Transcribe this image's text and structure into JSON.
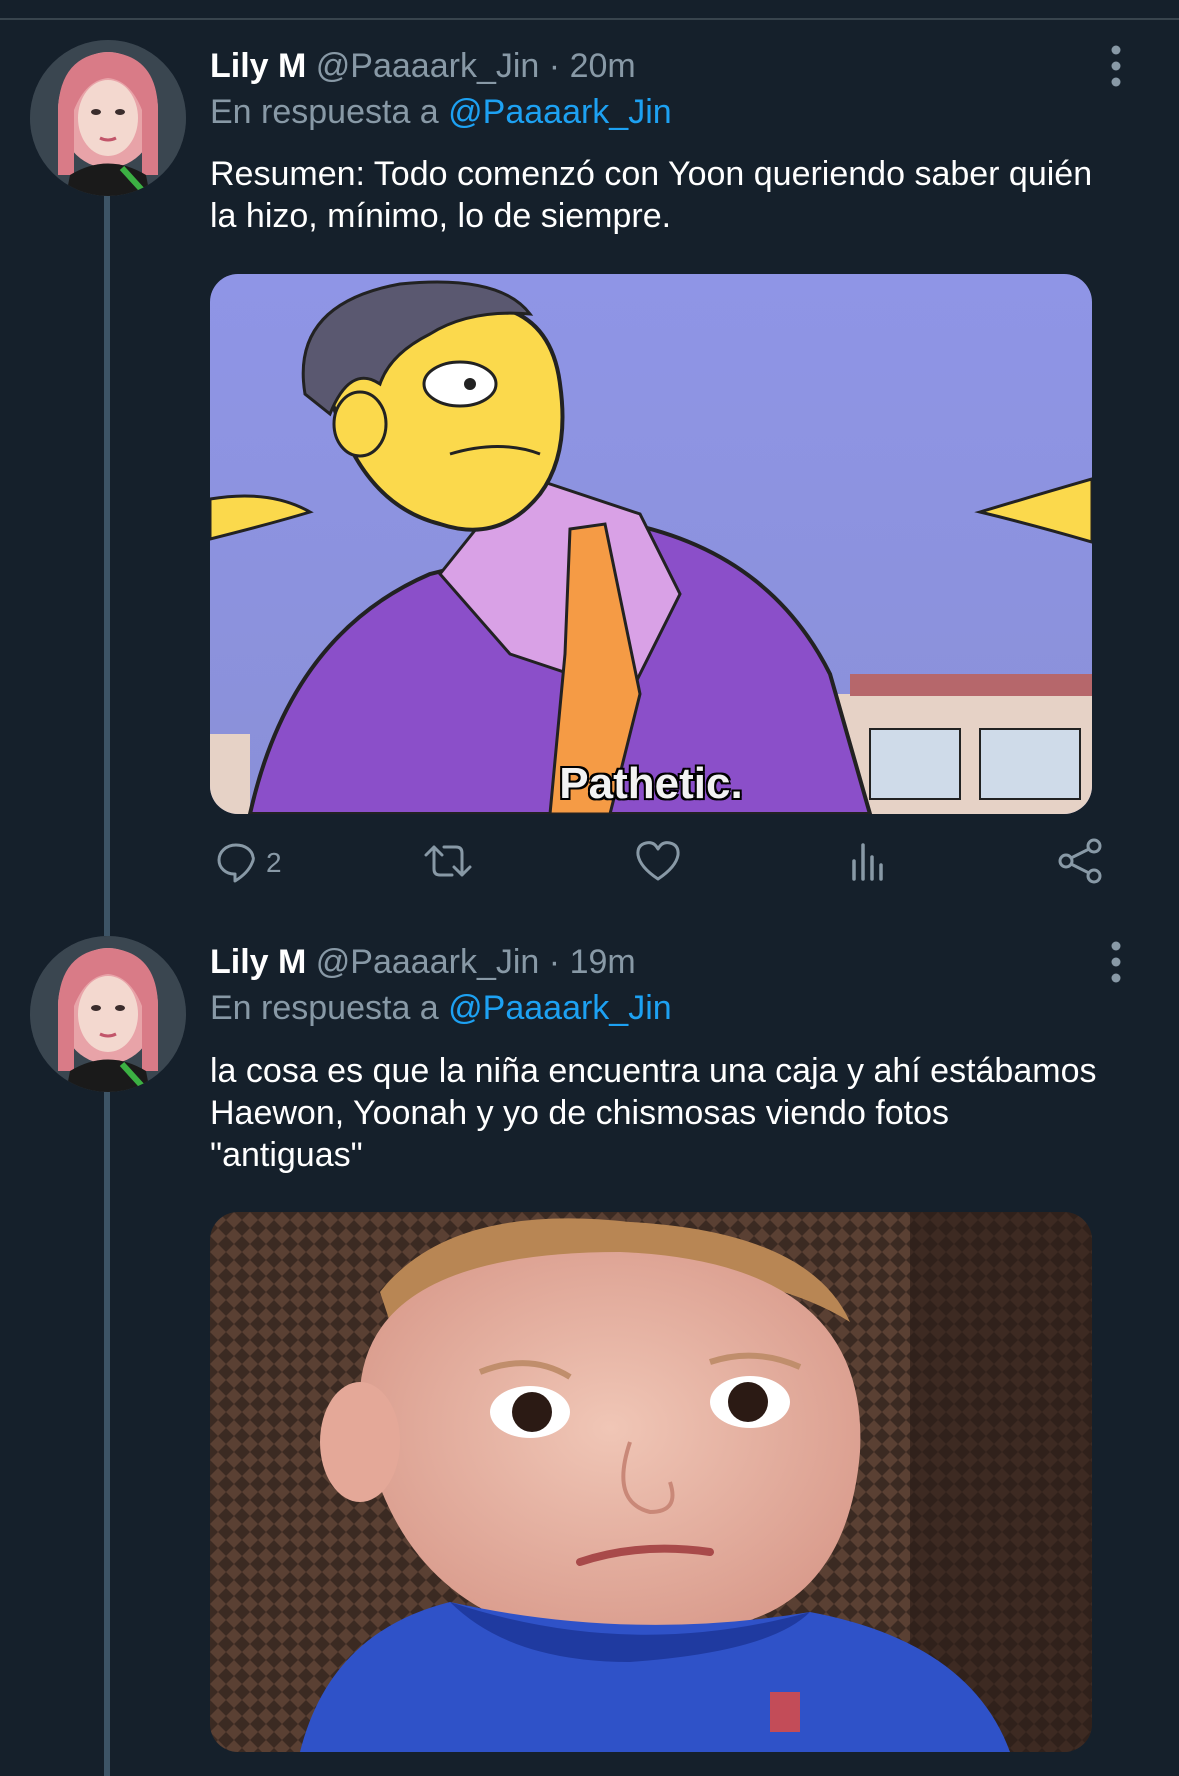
{
  "colors": {
    "background": "#15202b",
    "muted": "#8899a6",
    "link": "#1da1f2",
    "icon": "#8899a6"
  },
  "tweets": [
    {
      "name": "Lily M",
      "handle": "@Paaaark_Jin",
      "separator": "·",
      "time": "20m",
      "reply_prefix": "En respuesta a",
      "reply_mention": "@Paaaark_Jin",
      "text": "Resumen: Todo comenzó con Yoon queriendo saber quién la hizo, mínimo, lo de siempre.",
      "media_caption": "Pathetic.",
      "actions": {
        "reply_count": "2",
        "reply_icon": "comment-icon",
        "retweet_icon": "retweet-icon",
        "like_icon": "heart-icon",
        "analytics_icon": "analytics-icon",
        "share_icon": "share-icon"
      }
    },
    {
      "name": "Lily M",
      "handle": "@Paaaark_Jin",
      "separator": "·",
      "time": "19m",
      "reply_prefix": "En respuesta a",
      "reply_mention": "@Paaaark_Jin",
      "text": "la cosa es que la niña encuentra una caja y ahí estábamos Haewon, Yoonah y yo de chismosas viendo fotos \"antiguas\""
    }
  ]
}
